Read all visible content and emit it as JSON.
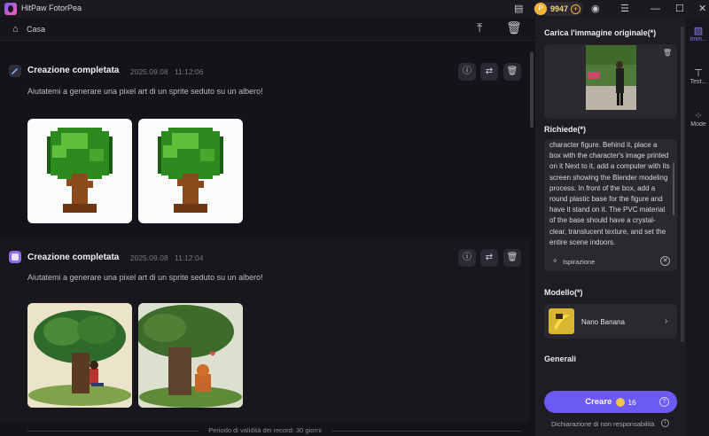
{
  "app": {
    "title": "HitPaw FotorPea",
    "coins": "9947",
    "coin_symbol": "P"
  },
  "header": {
    "home_label": "Casa"
  },
  "feed": {
    "items": [
      {
        "title": "Creazione completata",
        "date": "2025.09.08",
        "time": "11:12:06",
        "prompt": "Aiutatemi a generare una pixel art di un sprite seduto su un albero!"
      },
      {
        "title": "Creazione completata",
        "date": "2025.09.08",
        "time": "11:12:04",
        "prompt": "Aiutatemi a generare una pixel art di un sprite seduto su un albero!"
      }
    ],
    "footer": "Periodo di validità dei record: 30 giorni"
  },
  "panel": {
    "upload_label": "Carica l'immagine originale(*)",
    "request_label": "Richiede(*)",
    "request_text": "character figure. Behind it, place a box with the character's image printed on it Next to it, add a computer with its screen showing the Blender modeling process. In front of the box, add a round plastic base for the figure and have it stand on it. The PVC material of the base should have a crystal-clear, translucent texture, and set the entire scene indoors.",
    "inspiration": "Ispirazione",
    "model_label": "Modello(*)",
    "model_name": "Nano Banana",
    "general_label": "Generali",
    "create_label": "Creare",
    "create_cost": "16",
    "disclaimer": "Dichiarazione di non responsabilità"
  },
  "rail": {
    "items": [
      {
        "label": "Imm..."
      },
      {
        "label": "Test..."
      },
      {
        "label": "Mode"
      }
    ]
  }
}
